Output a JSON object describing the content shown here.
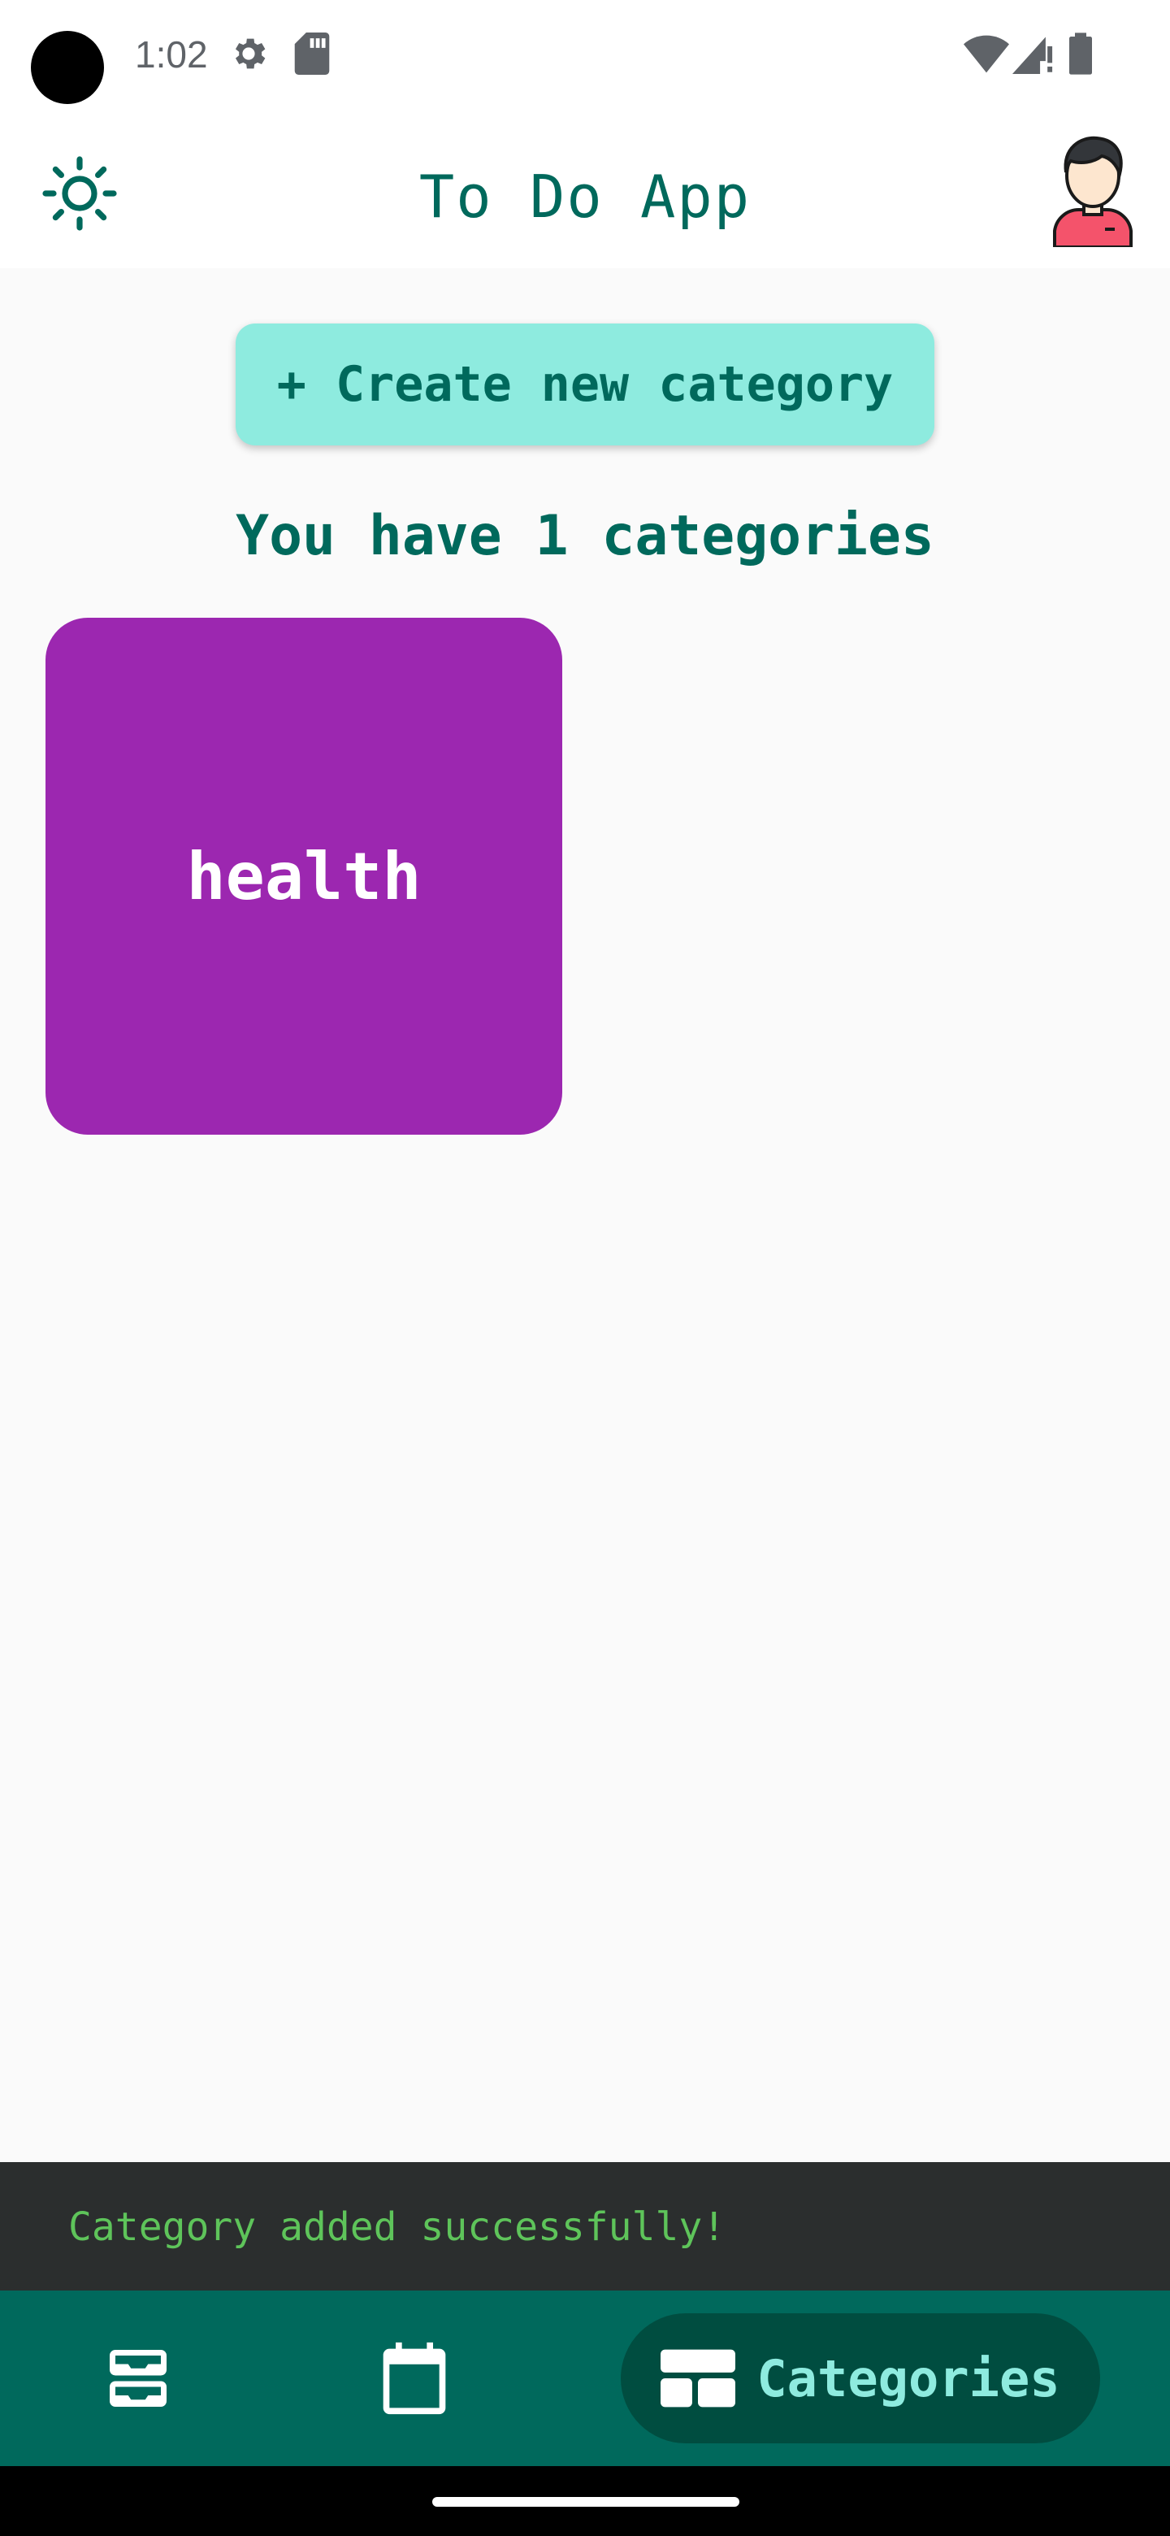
{
  "status_bar": {
    "time": "1:02",
    "icons": [
      "settings-gear-icon",
      "sd-card-icon",
      "wifi-icon",
      "cell-signal-icon",
      "battery-icon"
    ]
  },
  "app_bar": {
    "title": "To Do App",
    "theme_icon": "sun-icon",
    "avatar_icon": "user-avatar-icon"
  },
  "main": {
    "create_button_label": "+ Create new category",
    "count_text": "You have 1 categories",
    "categories": [
      {
        "label": "health",
        "color": "#9c27b0"
      }
    ]
  },
  "snackbar": {
    "message": "Category added successfully!"
  },
  "bottom_nav": {
    "items": [
      {
        "icon": "inbox-tray-icon"
      },
      {
        "icon": "calendar-icon"
      },
      {
        "icon": "dashboard-layout-icon",
        "label": "Categories",
        "active": true
      }
    ]
  },
  "colors": {
    "primary": "#00695c",
    "accent": "#8eebdf",
    "nav_active": "#004d40",
    "snackbar_bg": "#2b2e2e",
    "snackbar_text": "#5ec45a"
  }
}
